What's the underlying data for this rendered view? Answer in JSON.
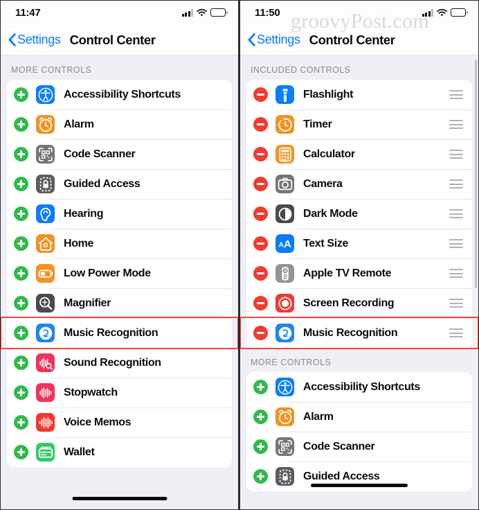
{
  "watermark": "groovyPost.com",
  "phones": [
    {
      "id": "left",
      "status": {
        "time": "11:47"
      },
      "nav": {
        "back_label": "Settings",
        "title": "Control Center"
      },
      "sections": [
        {
          "header": "MORE CONTROLS",
          "mode": "add",
          "rows": [
            {
              "label": "Accessibility Shortcuts",
              "icon": "accessibility-icon",
              "action": "add"
            },
            {
              "label": "Alarm",
              "icon": "alarm-icon",
              "action": "add"
            },
            {
              "label": "Code Scanner",
              "icon": "code-scanner-icon",
              "action": "add"
            },
            {
              "label": "Guided Access",
              "icon": "guided-access-icon",
              "action": "add"
            },
            {
              "label": "Hearing",
              "icon": "hearing-icon",
              "action": "add"
            },
            {
              "label": "Home",
              "icon": "home-icon",
              "action": "add"
            },
            {
              "label": "Low Power Mode",
              "icon": "low-power-mode-icon",
              "action": "add"
            },
            {
              "label": "Magnifier",
              "icon": "magnifier-icon",
              "action": "add"
            },
            {
              "label": "Music Recognition",
              "icon": "shazam-icon",
              "action": "add",
              "highlighted": true
            },
            {
              "label": "Sound Recognition",
              "icon": "sound-recognition-icon",
              "action": "add"
            },
            {
              "label": "Stopwatch",
              "icon": "stopwatch-icon",
              "action": "add"
            },
            {
              "label": "Voice Memos",
              "icon": "voice-memos-icon",
              "action": "add"
            },
            {
              "label": "Wallet",
              "icon": "wallet-icon",
              "action": "add"
            }
          ]
        }
      ]
    },
    {
      "id": "right",
      "status": {
        "time": "11:50"
      },
      "nav": {
        "back_label": "Settings",
        "title": "Control Center"
      },
      "sections": [
        {
          "header": "INCLUDED CONTROLS",
          "mode": "remove",
          "rows": [
            {
              "label": "Flashlight",
              "icon": "flashlight-icon",
              "action": "remove",
              "grip": true
            },
            {
              "label": "Timer",
              "icon": "timer-icon",
              "action": "remove",
              "grip": true
            },
            {
              "label": "Calculator",
              "icon": "calculator-icon",
              "action": "remove",
              "grip": true
            },
            {
              "label": "Camera",
              "icon": "camera-icon",
              "action": "remove",
              "grip": true
            },
            {
              "label": "Dark Mode",
              "icon": "dark-mode-icon",
              "action": "remove",
              "grip": true
            },
            {
              "label": "Text Size",
              "icon": "text-size-icon",
              "action": "remove",
              "grip": true
            },
            {
              "label": "Apple TV Remote",
              "icon": "apple-tv-remote-icon",
              "action": "remove",
              "grip": true
            },
            {
              "label": "Screen Recording",
              "icon": "screen-recording-icon",
              "action": "remove",
              "grip": true
            },
            {
              "label": "Music Recognition",
              "icon": "shazam-icon",
              "action": "remove",
              "grip": true,
              "highlighted": true
            }
          ]
        },
        {
          "header": "MORE CONTROLS",
          "mode": "add",
          "rows": [
            {
              "label": "Accessibility Shortcuts",
              "icon": "accessibility-icon",
              "action": "add"
            },
            {
              "label": "Alarm",
              "icon": "alarm-icon",
              "action": "add"
            },
            {
              "label": "Code Scanner",
              "icon": "code-scanner-icon",
              "action": "add"
            },
            {
              "label": "Guided Access",
              "icon": "guided-access-icon",
              "action": "add"
            }
          ]
        }
      ]
    }
  ],
  "colors": {
    "accent_blue": "#0a7cff",
    "add_green": "#30ba4b",
    "remove_red": "#f33a2f",
    "highlight_red": "#f4473b",
    "page_bg": "#f0eff5",
    "card_bg": "#ffffff",
    "header_text": "#8a8a8f"
  }
}
